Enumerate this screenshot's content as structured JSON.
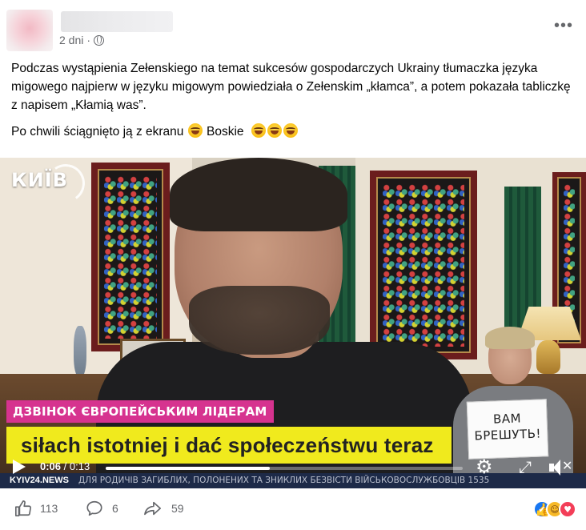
{
  "post": {
    "time_label": "2 dni",
    "separator": "·",
    "more_icon": "more-horizontal-icon",
    "privacy_icon": "globe-icon",
    "paragraph1": "Podczas wystąpienia Zełenskiego na temat sukcesów gospodarczych Ukrainy tłumaczka języka migowego najpierw w języku migowym powiedziała o Zełenskim „kłamca”, a potem pokazała tabliczkę z napisem „Kłamią was”.",
    "paragraph2_a": "Po chwili ściągnięto ją z ekranu",
    "paragraph2_b": "Boskie",
    "emoji_name": "rolling-on-floor-laughing-emoji"
  },
  "video": {
    "channel_logo": "КИЇВ",
    "pink_banner": "ДЗВІНОК ЄВРОПЕЙСЬКИМ ЛІДЕРАМ",
    "subtitle": "siłach istotniej i dać społeczeństwu teraz",
    "sign_line1": "ВАМ",
    "sign_line2": "БРЕШУТЬ!",
    "ticker_brand": "KYIV24.NEWS",
    "ticker_text": "ДЛЯ РОДИЧІВ ЗАГИБЛИХ, ПОЛОНЕНИХ ТА ЗНИКЛИХ БЕЗВІСТИ ВІЙСЬКОВОСЛУЖБОВЦІВ 1535",
    "current_time": "0:06",
    "duration": "/ 0:13",
    "progress_fraction": 0.46,
    "colors": {
      "pink": "#d6338f",
      "yellow": "#f0ea1d",
      "ticker": "#1d2a48"
    }
  },
  "footer": {
    "like_count": "113",
    "comment_count": "6",
    "share_count": "59",
    "reaction_icons": [
      "like-reaction-icon",
      "haha-reaction-icon",
      "love-reaction-icon"
    ]
  }
}
